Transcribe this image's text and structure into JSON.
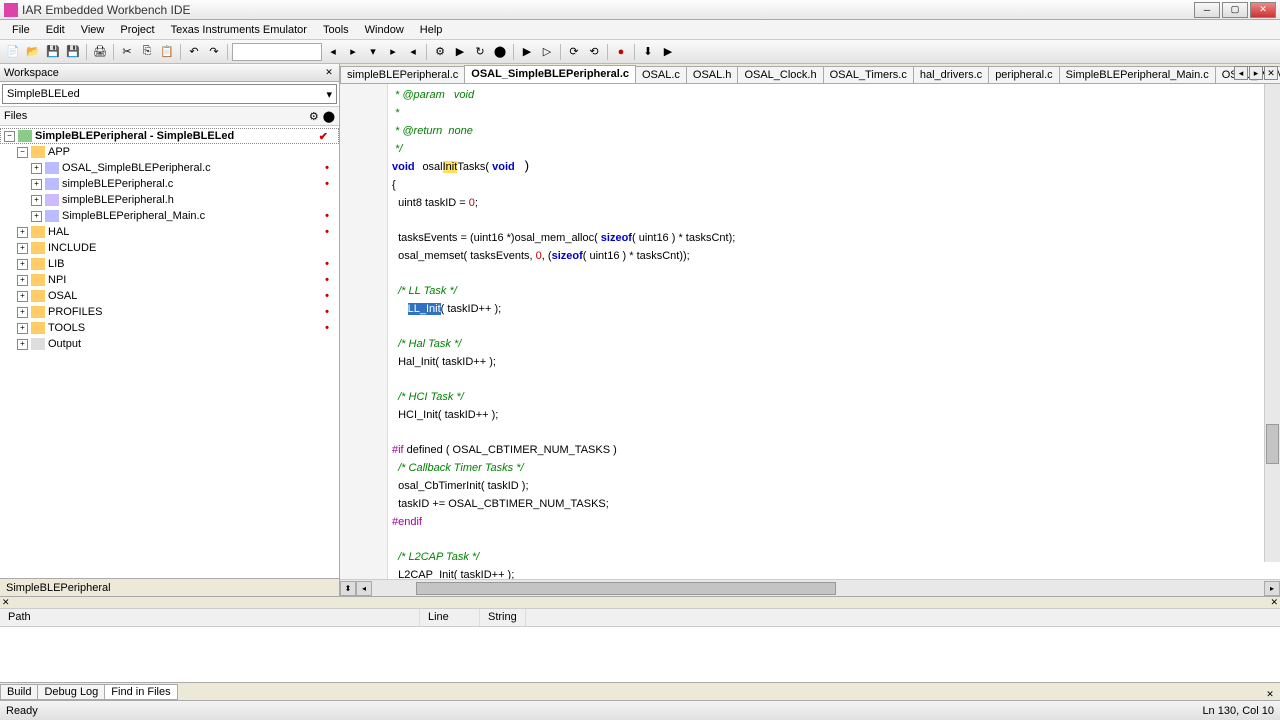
{
  "window": {
    "title": "IAR Embedded Workbench IDE"
  },
  "menu": [
    "File",
    "Edit",
    "View",
    "Project",
    "Texas Instruments Emulator",
    "Tools",
    "Window",
    "Help"
  ],
  "workspace": {
    "header": "Workspace",
    "config": "SimpleBLELed",
    "files_label": "Files",
    "project": "SimpleBLEPeripheral - SimpleBLELed",
    "folders": [
      {
        "name": "APP",
        "expanded": true,
        "children": [
          {
            "name": "OSAL_SimpleBLEPeripheral.c",
            "type": "c",
            "mark": "•"
          },
          {
            "name": "simpleBLEPeripheral.c",
            "type": "c",
            "mark": "•"
          },
          {
            "name": "simpleBLEPeripheral.h",
            "type": "h",
            "mark": ""
          },
          {
            "name": "SimpleBLEPeripheral_Main.c",
            "type": "c",
            "mark": "•"
          }
        ]
      },
      {
        "name": "HAL",
        "expanded": false,
        "mark": "•"
      },
      {
        "name": "INCLUDE",
        "expanded": false,
        "mark": ""
      },
      {
        "name": "LIB",
        "expanded": false,
        "mark": "•"
      },
      {
        "name": "NPI",
        "expanded": false,
        "mark": "•"
      },
      {
        "name": "OSAL",
        "expanded": false,
        "mark": "•"
      },
      {
        "name": "PROFILES",
        "expanded": false,
        "mark": "•"
      },
      {
        "name": "TOOLS",
        "expanded": false,
        "mark": "•"
      },
      {
        "name": "Output",
        "expanded": false,
        "type": "out",
        "mark": ""
      }
    ],
    "bottom_tab": "SimpleBLEPeripheral"
  },
  "editor_tabs": [
    {
      "label": "simpleBLEPeripheral.c",
      "active": false
    },
    {
      "label": "OSAL_SimpleBLEPeripheral.c",
      "active": true
    },
    {
      "label": "OSAL.c",
      "active": false
    },
    {
      "label": "OSAL.h",
      "active": false
    },
    {
      "label": "OSAL_Clock.h",
      "active": false
    },
    {
      "label": "OSAL_Timers.c",
      "active": false
    },
    {
      "label": "hal_drivers.c",
      "active": false
    },
    {
      "label": "peripheral.c",
      "active": false
    },
    {
      "label": "SimpleBLEPeripheral_Main.c",
      "active": false
    },
    {
      "label": "OSAL_PwrMgr.c",
      "active": false
    }
  ],
  "code": {
    "l1": " * @param   void",
    "l2": " *",
    "l3": " * @return  none",
    "l4": " */",
    "osalInit_pre": "osal",
    "osalInit_hl": "Init",
    "osalInit_post": "Tasks( ",
    "void_kw": "void",
    "l6": "{",
    "l7a": "  uint8 taskID = ",
    "l7b": "0",
    "l7c": ";",
    "l9a": "  tasksEvents = (uint16 *)osal_mem_alloc( ",
    "sizeof_kw": "sizeof",
    "l9b": "( uint16 ) * tasksCnt);",
    "l10a": "  osal_memset( tasksEvents, ",
    "l10b": "0",
    "l10c": ", (",
    "l10d": "( uint16 ) * tasksCnt));",
    "c_ll": "  /* LL Task */",
    "ll_sel": "LL_Init",
    "ll_post": "( taskID++ );",
    "c_hal": "  /* Hal Task */",
    "hal": "  Hal_Init( taskID++ );",
    "c_hci": "  /* HCI Task */",
    "hci": "  HCI_Init( taskID++ );",
    "pp_if": "#if",
    "if_body": " defined ( OSAL_CBTIMER_NUM_TASKS )",
    "c_cb": "  /* Callback Timer Tasks */",
    "cb1": "  osal_CbTimerInit( taskID );",
    "cb2": "  taskID += OSAL_CBTIMER_NUM_TASKS;",
    "pp_endif": "#endif",
    "c_l2cap": "  /* L2CAP Task */",
    "l2cap": "  L2CAP_Init( taskID++ );"
  },
  "bottom": {
    "cols": [
      "Path",
      "Line",
      "String"
    ],
    "tabs": [
      "Build",
      "Debug Log",
      "Find in Files"
    ],
    "active_tab": 2
  },
  "status": {
    "left": "Ready",
    "right": "Ln 130, Col 10"
  }
}
